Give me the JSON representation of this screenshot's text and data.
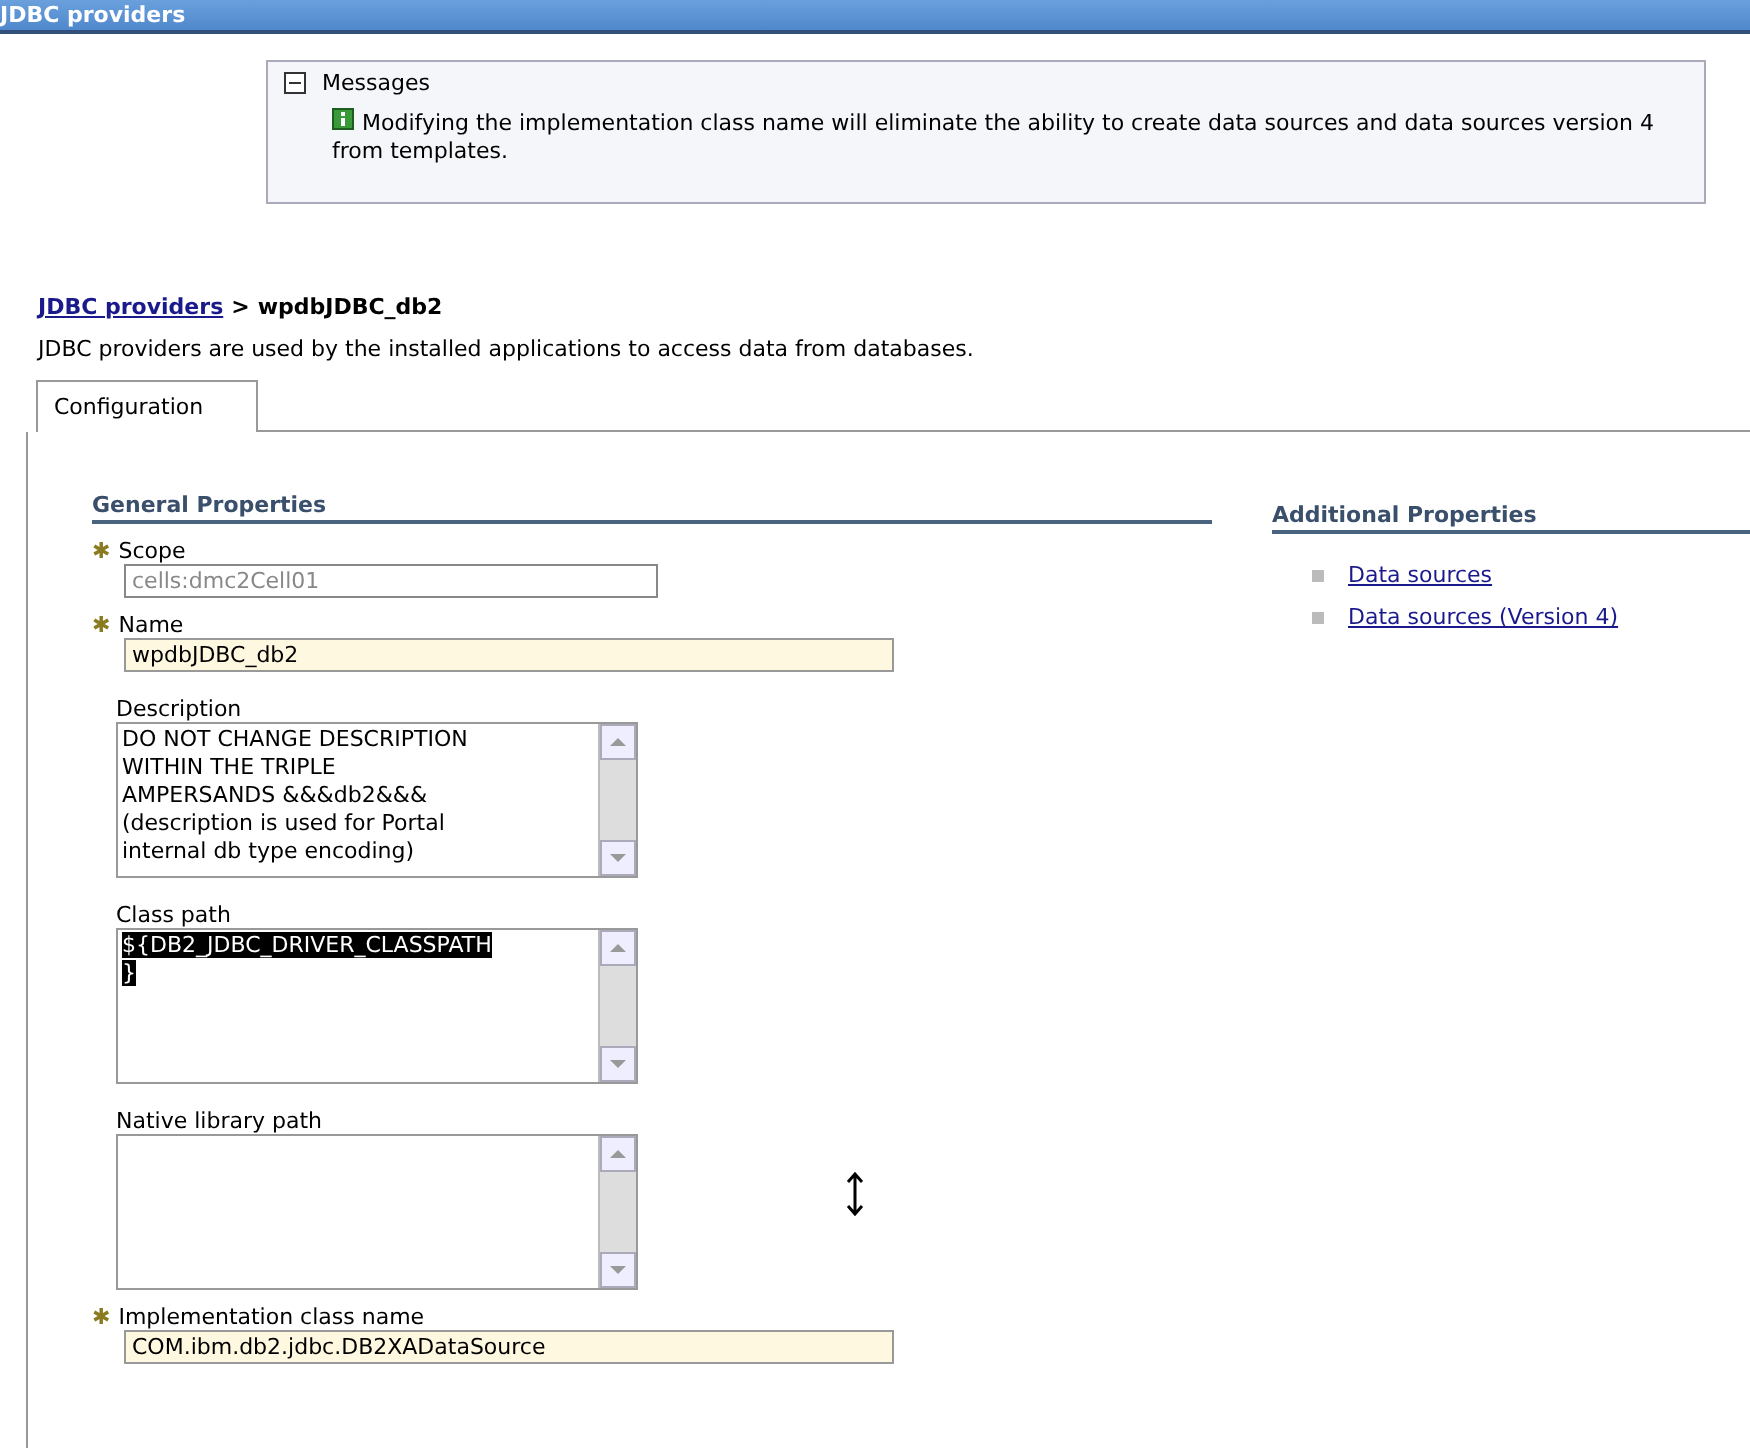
{
  "title_bar": {
    "title": "JDBC providers"
  },
  "messages": {
    "expanded": true,
    "heading": "Messages",
    "text": "Modifying the implementation class name will eliminate the ability to create data sources and data sources version 4 from templates."
  },
  "breadcrumb": {
    "link": "JDBC providers",
    "separator": ">",
    "current": "wpdbJDBC_db2"
  },
  "description": "JDBC providers are used by the installed applications to access data from databases.",
  "tabs": [
    {
      "label": "Configuration",
      "selected": true
    }
  ],
  "general_properties": {
    "heading": "General Properties",
    "fields": [
      {
        "kind": "text",
        "label": "Scope",
        "required_mark": "✱",
        "disabled": true,
        "value": "cells:dmc2Cell01"
      },
      {
        "kind": "text",
        "label": "Name",
        "required_mark": "✱",
        "disabled": false,
        "value": "wpdbJDBC_db2"
      },
      {
        "kind": "textarea",
        "label": "Description",
        "text_selected": false,
        "lines": [
          "DO NOT CHANGE DESCRIPTION",
          "WITHIN THE TRIPLE",
          "AMPERSANDS &&&db2&&&",
          "(description is used for Portal",
          "internal db type encoding)"
        ]
      },
      {
        "kind": "textarea",
        "label": "Class path",
        "text_selected": true,
        "lines": [
          "${DB2_JDBC_DRIVER_CLASSPATH",
          "}"
        ]
      },
      {
        "kind": "textarea",
        "label": "Native library path"
      },
      {
        "kind": "text",
        "label": "Implementation class name",
        "required_mark": "✱",
        "disabled": false,
        "value": "COM.ibm.db2.jdbc.DB2XADataSource"
      }
    ]
  },
  "additional_properties": {
    "heading": "Additional Properties",
    "links": [
      "Data sources",
      "Data sources (Version 4)"
    ]
  }
}
